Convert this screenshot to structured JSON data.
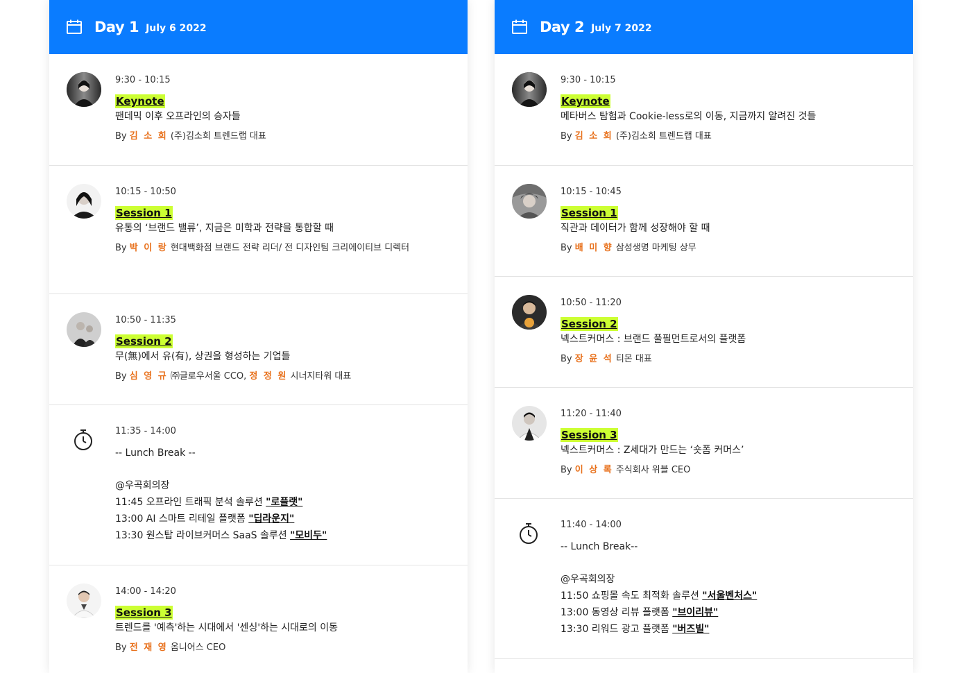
{
  "day1": {
    "label": "Day 1",
    "date": "July 6 2022",
    "sessions": [
      {
        "time": "9:30 - 10:15",
        "tag": "Keynote",
        "title": "팬데믹 이후 오프라인의 승자들",
        "by": "By",
        "speaker": "김 소 희",
        "role": " (주)김소희 트렌드랩 대표"
      },
      {
        "time": "10:15 - 10:50",
        "tag": "Session 1",
        "title": "유통의 ‘브랜드 밸류’, 지금은 미학과 전략을 통합할 때",
        "by": "By",
        "speaker": "박 이 랑",
        "role": " 현대백화점 브랜드 전략 리더/ 전 디자인팀 크리에이티브 디렉터"
      },
      {
        "time": "10:50 - 11:35",
        "tag": "Session 2",
        "title": "무(無)에서 유(有), 상권을 형성하는 기업들",
        "by": "By",
        "speaker": "심 영 규",
        "role": " ㈜글로우서울 CCO, ",
        "speaker2": "정 정 원",
        "role2": " 시너지타워 대표"
      }
    ],
    "break": {
      "time": "11:35 - 14:00",
      "title": "-- Lunch Break --",
      "venue": "@우곡회의장",
      "items": [
        {
          "text": "11:45 오프라인 트래픽 분석 솔루션 ",
          "link": "\"로플랫\""
        },
        {
          "text": "13:00 AI 스마트 리테일 플랫폼 ",
          "link": "\"딥라운지\""
        },
        {
          "text": "13:30 원스탑 라이브커머스 SaaS 솔루션 ",
          "link": "\"모비두\""
        }
      ]
    },
    "session3": {
      "time": "14:00 - 14:20",
      "tag": "Session 3",
      "title": "트렌드를 '예측'하는 시대에서 '센싱'하는 시대로의 이동",
      "by": "By",
      "speaker": "전 재 영",
      "role": " 옴니어스 CEO"
    }
  },
  "day2": {
    "label": "Day 2",
    "date": "July 7 2022",
    "sessions": [
      {
        "time": "9:30 - 10:15",
        "tag": "Keynote",
        "title": "메타버스 탐험과 Cookie-less로의 이동, 지금까지 알려진 것들",
        "by": "By",
        "speaker": "김 소 희",
        "role": " (주)김소희 트렌드랩 대표"
      },
      {
        "time": "10:15 - 10:45",
        "tag": "Session 1",
        "title": "직관과 데이터가 함께 성장해야 할 때",
        "by": "By",
        "speaker": "배 미 향",
        "role": " 삼성생명 마케팅 상무"
      },
      {
        "time": "10:50 - 11:20",
        "tag": "Session 2",
        "title": "넥스트커머스 : 브랜드 풀필먼트로서의 플랫폼",
        "by": "By",
        "speaker": "장 윤 석",
        "role": " 티몬 대표"
      },
      {
        "time": "11:20 - 11:40",
        "tag": "Session 3",
        "title": "넥스트커머스 : Z세대가 만드는 ‘숏폼 커머스’",
        "by": "By",
        "speaker": "이 상 록",
        "role": " 주식회사 위블 CEO"
      }
    ],
    "break": {
      "time": "11:40 - 14:00",
      "title": "-- Lunch Break--",
      "venue": "@우곡회의장",
      "items": [
        {
          "text": "11:50 쇼핑몰 속도 최적화 솔루션 ",
          "link": "\"서울벤처스\""
        },
        {
          "text": "13:00 동영상 리뷰 플랫폼 ",
          "link": "\"브이리뷰\""
        },
        {
          "text": "13:30 리워드 광고 플랫폼 ",
          "link": "\"버즈빌\""
        }
      ]
    }
  },
  "colors": {
    "header_blue": "#0a7cff",
    "tag_highlight": "#ccff33",
    "speaker_orange": "#e8711c"
  },
  "icons": {
    "header": "calendar-icon",
    "break": "stopwatch-icon"
  }
}
